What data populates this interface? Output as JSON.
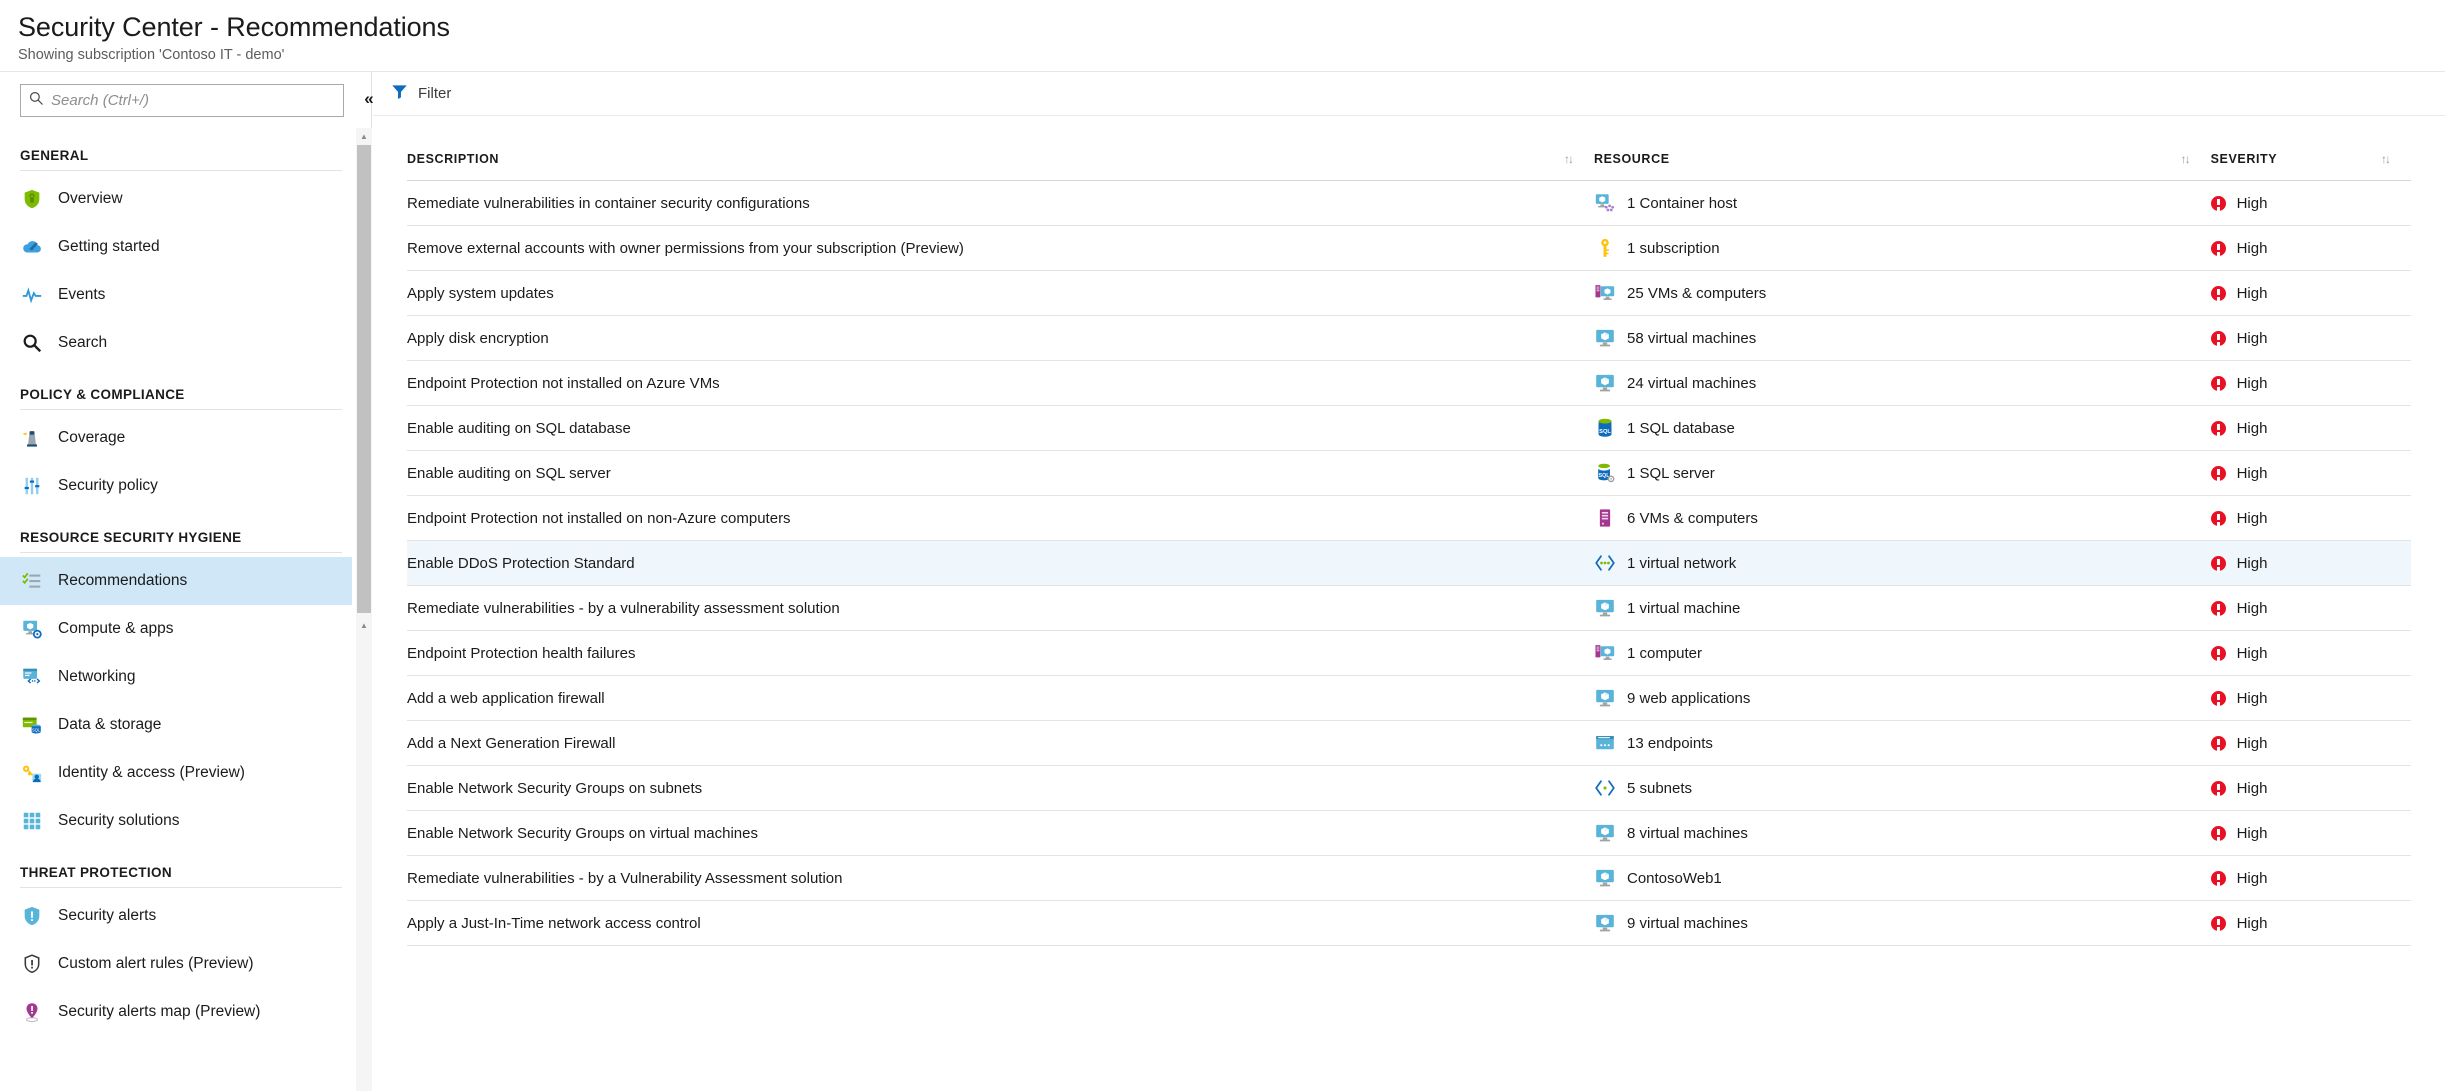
{
  "header": {
    "title": "Security Center - Recommendations",
    "subtitle": "Showing subscription 'Contoso IT - demo'"
  },
  "sidebar": {
    "search": {
      "placeholder": "Search (Ctrl+/)",
      "value": ""
    },
    "collapse_label": "«",
    "groups": [
      {
        "title": "GENERAL",
        "items": [
          {
            "label": "Overview",
            "icon": "shield-icon",
            "active": false
          },
          {
            "label": "Getting started",
            "icon": "cloud-rocket-icon",
            "active": false
          },
          {
            "label": "Events",
            "icon": "pulse-icon",
            "active": false
          },
          {
            "label": "Search",
            "icon": "magnifier-icon",
            "active": false
          }
        ]
      },
      {
        "title": "POLICY & COMPLIANCE",
        "items": [
          {
            "label": "Coverage",
            "icon": "lighthouse-icon",
            "active": false
          },
          {
            "label": "Security policy",
            "icon": "sliders-icon",
            "active": false
          }
        ]
      },
      {
        "title": "RESOURCE SECURITY HYGIENE",
        "items": [
          {
            "label": "Recommendations",
            "icon": "checklist-icon",
            "active": true
          },
          {
            "label": "Compute & apps",
            "icon": "monitor-gear-icon",
            "active": false
          },
          {
            "label": "Networking",
            "icon": "network-window-icon",
            "active": false
          },
          {
            "label": "Data & storage",
            "icon": "database-card-icon",
            "active": false
          },
          {
            "label": "Identity & access (Preview)",
            "icon": "key-user-icon",
            "active": false
          },
          {
            "label": "Security solutions",
            "icon": "grid-icon",
            "active": false
          }
        ]
      },
      {
        "title": "THREAT PROTECTION",
        "items": [
          {
            "label": "Security alerts",
            "icon": "shield-alert-icon",
            "active": false
          },
          {
            "label": "Custom alert rules (Preview)",
            "icon": "shield-outline-icon",
            "active": false
          },
          {
            "label": "Security alerts map (Preview)",
            "icon": "map-pin-alert-icon",
            "active": false
          }
        ]
      }
    ]
  },
  "toolbar": {
    "filter_label": "Filter",
    "filter_icon": "funnel-icon"
  },
  "table": {
    "columns": [
      {
        "key": "description",
        "label": "DESCRIPTION",
        "sort_icon": "sort-updown-icon"
      },
      {
        "key": "resource",
        "label": "RESOURCE",
        "sort_icon": "sort-updown-icon"
      },
      {
        "key": "severity",
        "label": "SEVERITY",
        "sort_icon": "sort-updown-icon"
      }
    ],
    "rows": [
      {
        "description": "Remediate vulnerabilities in container security configurations",
        "resource": "1 Container host",
        "resource_icon": "container-host-icon",
        "severity": "High",
        "severity_icon": "high-severity-icon",
        "selected": false
      },
      {
        "description": "Remove external accounts with owner permissions from your subscription (Preview)",
        "resource": "1 subscription",
        "resource_icon": "key-icon",
        "severity": "High",
        "severity_icon": "high-severity-icon",
        "selected": false
      },
      {
        "description": "Apply system updates",
        "resource": "25 VMs & computers",
        "resource_icon": "vm-computer-icon",
        "severity": "High",
        "severity_icon": "high-severity-icon",
        "selected": false
      },
      {
        "description": "Apply disk encryption",
        "resource": "58 virtual machines",
        "resource_icon": "virtual-machine-icon",
        "severity": "High",
        "severity_icon": "high-severity-icon",
        "selected": false
      },
      {
        "description": "Endpoint Protection not installed on Azure VMs",
        "resource": "24 virtual machines",
        "resource_icon": "virtual-machine-icon",
        "severity": "High",
        "severity_icon": "high-severity-icon",
        "selected": false
      },
      {
        "description": "Enable auditing on SQL database",
        "resource": "1 SQL database",
        "resource_icon": "sql-database-icon",
        "severity": "High",
        "severity_icon": "high-severity-icon",
        "selected": false
      },
      {
        "description": "Enable auditing on SQL server",
        "resource": "1 SQL server",
        "resource_icon": "sql-server-icon",
        "severity": "High",
        "severity_icon": "high-severity-icon",
        "selected": false
      },
      {
        "description": "Endpoint Protection not installed on non-Azure computers",
        "resource": "6 VMs & computers",
        "resource_icon": "server-icon",
        "severity": "High",
        "severity_icon": "high-severity-icon",
        "selected": false
      },
      {
        "description": "Enable DDoS Protection Standard",
        "resource": "1 virtual network",
        "resource_icon": "virtual-network-icon",
        "severity": "High",
        "severity_icon": "high-severity-icon",
        "selected": true
      },
      {
        "description": "Remediate vulnerabilities - by a vulnerability assessment solution",
        "resource": "1 virtual machine",
        "resource_icon": "virtual-machine-icon",
        "severity": "High",
        "severity_icon": "high-severity-icon",
        "selected": false
      },
      {
        "description": "Endpoint Protection health failures",
        "resource": "1 computer",
        "resource_icon": "vm-computer-icon",
        "severity": "High",
        "severity_icon": "high-severity-icon",
        "selected": false
      },
      {
        "description": "Add a web application firewall",
        "resource": "9 web applications",
        "resource_icon": "virtual-machine-icon",
        "severity": "High",
        "severity_icon": "high-severity-icon",
        "selected": false
      },
      {
        "description": "Add a Next Generation Firewall",
        "resource": "13 endpoints",
        "resource_icon": "endpoint-window-icon",
        "severity": "High",
        "severity_icon": "high-severity-icon",
        "selected": false
      },
      {
        "description": "Enable Network Security Groups on subnets",
        "resource": "5 subnets",
        "resource_icon": "subnet-icon",
        "severity": "High",
        "severity_icon": "high-severity-icon",
        "selected": false
      },
      {
        "description": "Enable Network Security Groups on virtual machines",
        "resource": "8 virtual machines",
        "resource_icon": "virtual-machine-icon",
        "severity": "High",
        "severity_icon": "high-severity-icon",
        "selected": false
      },
      {
        "description": "Remediate vulnerabilities - by a Vulnerability Assessment solution",
        "resource": "ContosoWeb1",
        "resource_icon": "virtual-machine-icon",
        "severity": "High",
        "severity_icon": "high-severity-icon",
        "selected": false
      },
      {
        "description": "Apply a Just-In-Time network access control",
        "resource": "9 virtual machines",
        "resource_icon": "virtual-machine-icon",
        "severity": "High",
        "severity_icon": "high-severity-icon",
        "selected": false
      }
    ]
  },
  "colors": {
    "accent": "#0078d4",
    "severity_high": "#e81123",
    "selected_row": "#eff6fc",
    "nav_active": "#cfe7f7"
  }
}
